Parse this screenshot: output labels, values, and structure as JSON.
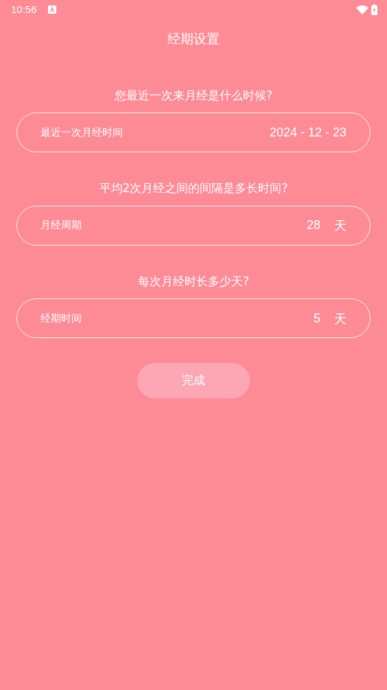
{
  "status_bar": {
    "time": "10:56"
  },
  "title": "经期设置",
  "sections": [
    {
      "question": "您最近一次来月经是什么时候?",
      "label": "最近一次月经时间",
      "value": "2024 - 12 - 23"
    },
    {
      "question": "平均2次月经之间的间隔是多长时间?",
      "label": "月经周期",
      "value": "28",
      "unit": "天"
    },
    {
      "question": "每次月经时长多少天?",
      "label": "经期时间",
      "value": "5",
      "unit": "天"
    }
  ],
  "button": "完成"
}
